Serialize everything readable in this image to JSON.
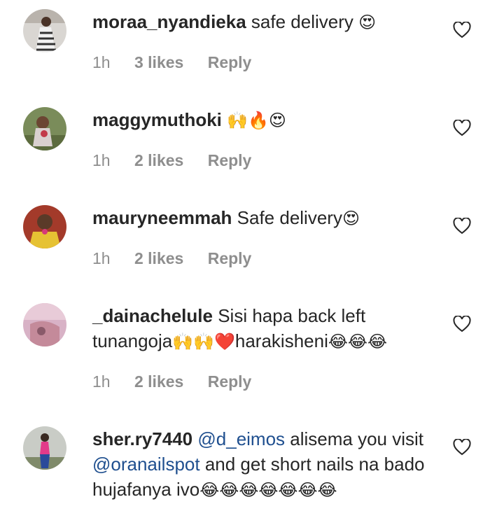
{
  "comments": [
    {
      "username": "moraa_nyandieka",
      "text_parts": [
        "safe delivery",
        "😍"
      ],
      "time": "1h",
      "likes": "3 likes",
      "reply": "Reply",
      "avatar_icon": "avatar-photo"
    },
    {
      "username": "maggymuthoki",
      "text_parts": [
        "🙌🔥😍"
      ],
      "time": "1h",
      "likes": "2 likes",
      "reply": "Reply",
      "avatar_icon": "avatar-photo"
    },
    {
      "username": "mauryneemmah",
      "text_parts": [
        "Safe delivery",
        "😍"
      ],
      "time": "1h",
      "likes": "2 likes",
      "reply": "Reply",
      "avatar_icon": "avatar-photo"
    },
    {
      "username": "_dainachelule",
      "text_parts": [
        "Sisi hapa back left tunangoja",
        "🙌🙌❤️",
        "harakisheni",
        "😂😂😂"
      ],
      "time": "1h",
      "likes": "2 likes",
      "reply": "Reply",
      "avatar_icon": "avatar-photo"
    },
    {
      "username": "sher.ry7440",
      "mention1": "@d_eimos",
      "text1": "alisema you visit",
      "mention2": "@oranailspot",
      "text2": "and get short nails na bado hujafanya ivo",
      "emoji_tail": "😂😂😂😂😂😂😂",
      "avatar_icon": "avatar-photo"
    }
  ],
  "icons": {
    "like": "heart-outline-icon"
  },
  "colors": {
    "text": "#262626",
    "meta": "#8e8e8e",
    "mention": "#1f4f8f"
  }
}
